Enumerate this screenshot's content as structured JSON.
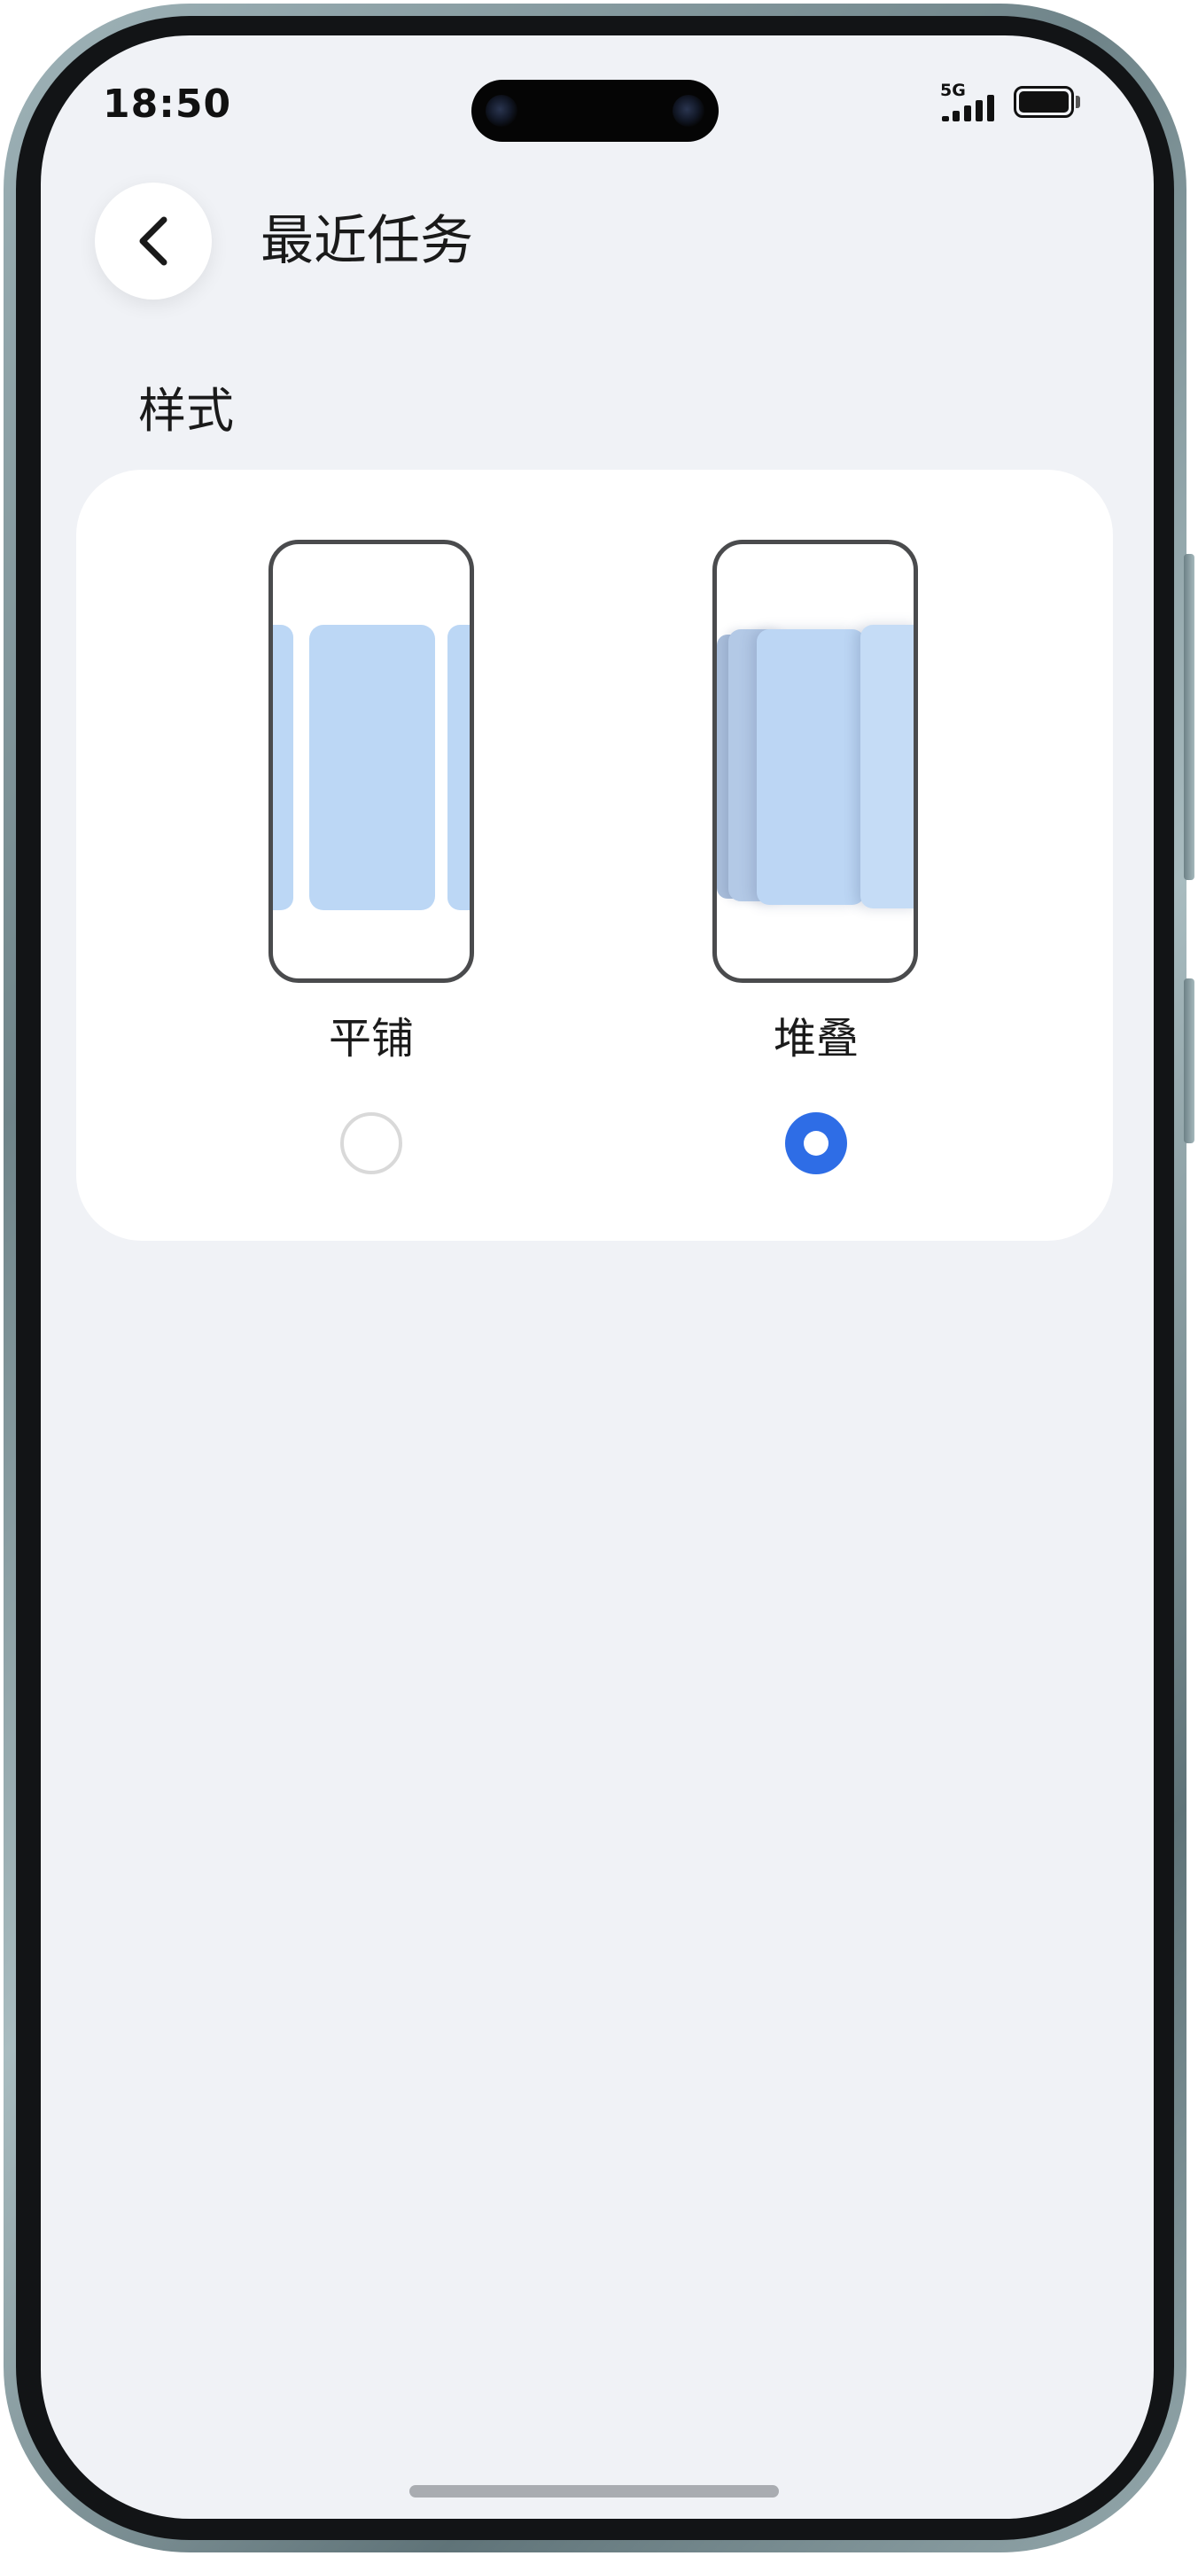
{
  "status_bar": {
    "time": "18:50",
    "network": "5G",
    "signal_icon": "signal-bars-icon",
    "battery_icon": "battery-icon"
  },
  "header": {
    "back_icon": "chevron-left-icon",
    "title": "最近任务"
  },
  "section": {
    "title": "样式"
  },
  "style_options": [
    {
      "label": "平铺",
      "preview": "tiled",
      "selected": false
    },
    {
      "label": "堆叠",
      "preview": "stacked",
      "selected": true
    }
  ],
  "colors": {
    "screen_bg": "#f0f2f6",
    "card_bg": "#ffffff",
    "accent": "#2e6de6",
    "preview_card": "#bcd7f5",
    "radio_border": "#d9d9d9"
  }
}
